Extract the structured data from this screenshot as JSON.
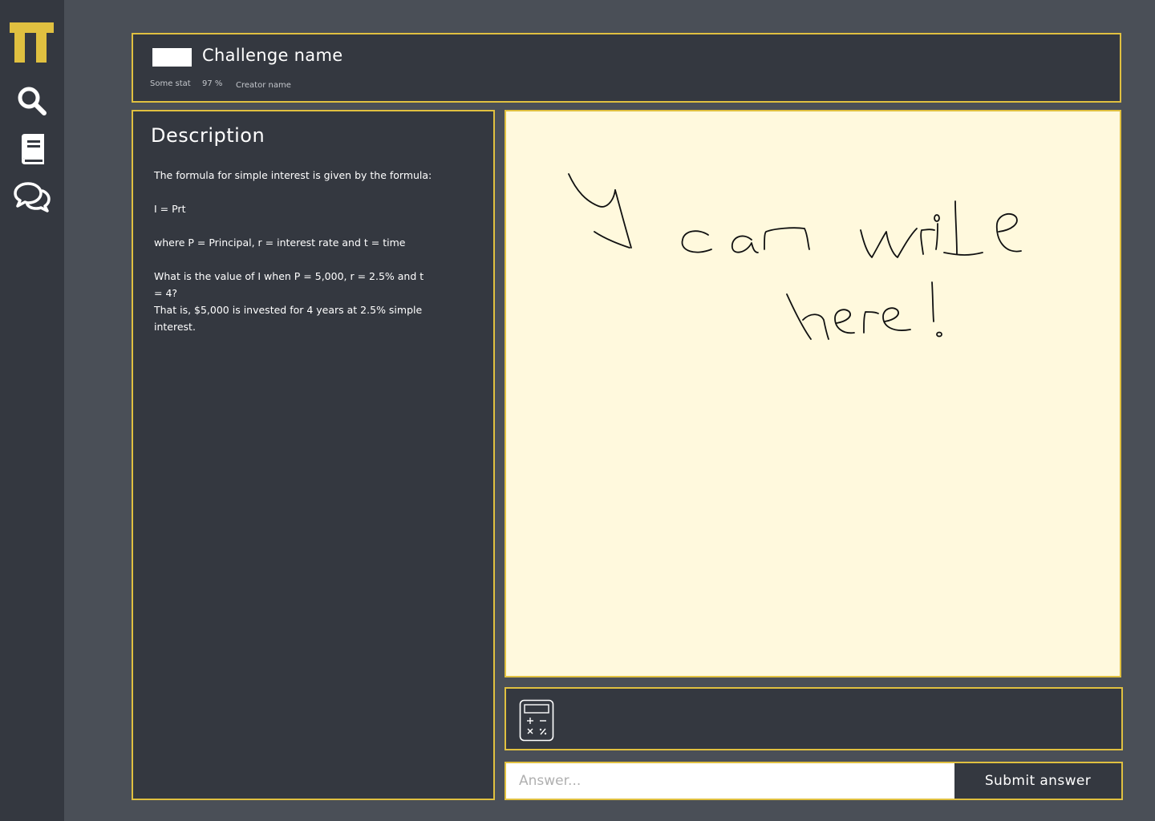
{
  "app": {
    "accent_color": "#e0c040",
    "sidebar_bg": "#343840",
    "page_bg": "#4a4f57"
  },
  "sidebar": {
    "logo_icon": "pi-logo-icon",
    "items": [
      {
        "icon": "search-icon"
      },
      {
        "icon": "book-icon"
      },
      {
        "icon": "chat-icon"
      }
    ]
  },
  "header": {
    "title": "Challenge name",
    "stats": [
      "Some stat",
      "97 %",
      "Creator name"
    ]
  },
  "description": {
    "heading": "Description",
    "paragraphs": [
      "The formula for simple interest is given by the formula:",
      "I = Prt",
      "where P = Principal, r = interest rate and t = time",
      "What is the value of I when P = 5,000, r = 2.5% and t = 4?",
      "That is, $5,000 is invested for 4 years at 2.5% simple interest."
    ]
  },
  "canvas": {
    "handwriting": "I can write here!",
    "background": "#fff9dd"
  },
  "tools": {
    "calculator_icon": "calculator-icon"
  },
  "answer": {
    "placeholder": "Answer...",
    "value": "",
    "submit_label": "Submit answer"
  }
}
